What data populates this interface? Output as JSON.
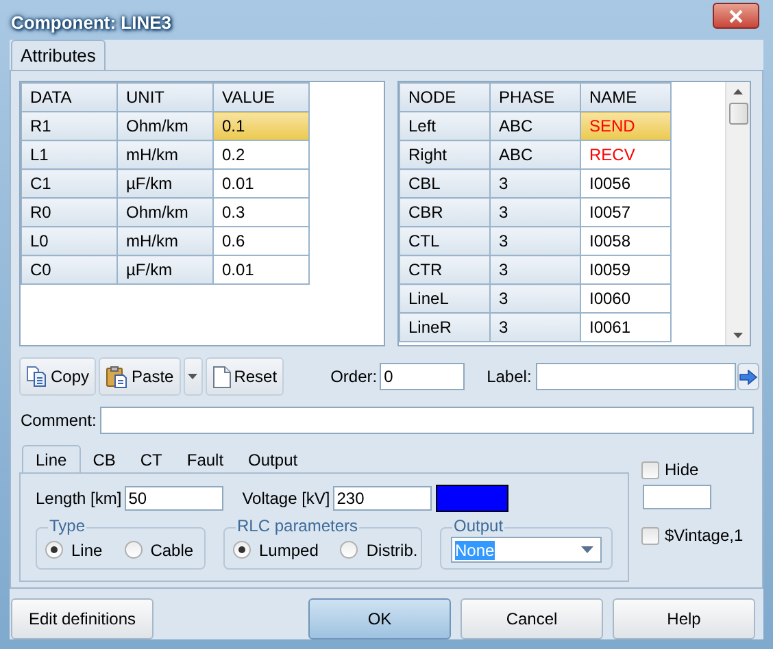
{
  "window": {
    "title": "Component: LINE3"
  },
  "tabs": [
    {
      "label": "Attributes",
      "selected": true
    }
  ],
  "data_table": {
    "columns": [
      "DATA",
      "UNIT",
      "VALUE"
    ],
    "rows": [
      {
        "cells": [
          "R1",
          "Ohm/km",
          "0.1"
        ],
        "selected": true
      },
      {
        "cells": [
          "L1",
          "mH/km",
          "0.2"
        ],
        "selected": false
      },
      {
        "cells": [
          "C1",
          "µF/km",
          "0.01"
        ],
        "selected": false
      },
      {
        "cells": [
          "R0",
          "Ohm/km",
          "0.3"
        ],
        "selected": false
      },
      {
        "cells": [
          "L0",
          "mH/km",
          "0.6"
        ],
        "selected": false
      },
      {
        "cells": [
          "C0",
          "µF/km",
          "0.01"
        ],
        "selected": false
      }
    ]
  },
  "node_table": {
    "columns": [
      "NODE",
      "PHASE",
      "NAME"
    ],
    "rows": [
      {
        "cells": [
          "Left",
          "ABC",
          "SEND"
        ],
        "selected": true,
        "color": "#ff0000"
      },
      {
        "cells": [
          "Right",
          "ABC",
          "RECV"
        ],
        "selected": false,
        "color": "#ff0000"
      },
      {
        "cells": [
          "CBL",
          "3",
          "I0056"
        ],
        "selected": false,
        "color": "#000000"
      },
      {
        "cells": [
          "CBR",
          "3",
          "I0057"
        ],
        "selected": false,
        "color": "#000000"
      },
      {
        "cells": [
          "CTL",
          "3",
          "I0058"
        ],
        "selected": false,
        "color": "#000000"
      },
      {
        "cells": [
          "CTR",
          "3",
          "I0059"
        ],
        "selected": false,
        "color": "#000000"
      },
      {
        "cells": [
          "LineL",
          "3",
          "I0060"
        ],
        "selected": false,
        "color": "#000000"
      },
      {
        "cells": [
          "LineR",
          "3",
          "I0061"
        ],
        "selected": false,
        "color": "#000000"
      }
    ]
  },
  "toolbar": [
    {
      "label": "Copy",
      "kind": "copy"
    },
    {
      "label": "Paste",
      "kind": "paste"
    },
    {
      "kind": "dropdown"
    },
    {
      "label": "Reset",
      "kind": "reset"
    }
  ],
  "order": {
    "label": "Order:",
    "value": "0"
  },
  "label_field": {
    "label": "Label:"
  },
  "comment": {
    "label": "Comment:"
  },
  "sub_tabs": [
    {
      "label": "Line",
      "selected": true
    },
    {
      "label": "CB",
      "selected": false
    },
    {
      "label": "CT",
      "selected": false
    },
    {
      "label": "Fault",
      "selected": false
    },
    {
      "label": "Output",
      "selected": false
    }
  ],
  "length": {
    "label": "Length [km]",
    "value": "50"
  },
  "voltage": {
    "label": "Voltage [kV]",
    "value": "230",
    "color": "#0000ff"
  },
  "type_group": {
    "title": "Type",
    "options": [
      {
        "label": "Line",
        "selected": true
      },
      {
        "label": "Cable",
        "selected": false
      }
    ]
  },
  "rlc_group": {
    "title": "RLC parameters",
    "options": [
      {
        "label": "Lumped",
        "selected": true
      },
      {
        "label": "Distrib.",
        "selected": false
      }
    ]
  },
  "output_group": {
    "title": "Output",
    "value": "None"
  },
  "hide": {
    "label": "Hide",
    "checked": false
  },
  "vintage": {
    "label": "$Vintage,1",
    "checked": false
  },
  "buttons": [
    {
      "label": "Edit definitions",
      "kind": "normal"
    },
    {
      "label": "OK",
      "kind": "default"
    },
    {
      "label": "Cancel",
      "kind": "normal"
    },
    {
      "label": "Help",
      "kind": "normal"
    }
  ]
}
